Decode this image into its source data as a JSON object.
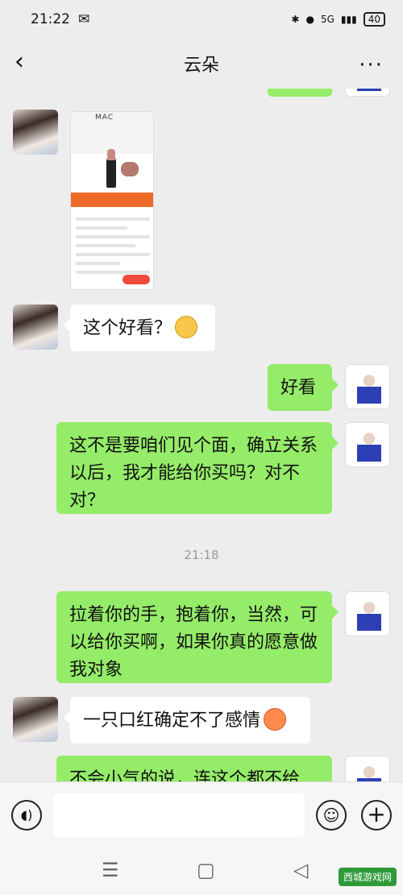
{
  "status": {
    "time": "21:22",
    "signal": "5G",
    "battery": "40"
  },
  "header": {
    "title": "云朵",
    "back_icon": "‹",
    "more_icon": "···"
  },
  "messages": {
    "m2": "这个好看？",
    "m3": "好看",
    "m4": "这不是要咱们见个面，确立关系以后，我才能给你买吗？对不对？",
    "timestamp": "21:18",
    "m5": "拉着你的手，抱着你，当然，可以给你买啊，如果你真的愿意做我对象",
    "m6": "一只口红确定不了感情",
    "m7": "不会小气的说，连这个都不给"
  },
  "shared_screenshot": {
    "brand": "MAC"
  },
  "inputbar": {
    "placeholder": "",
    "voice_icon": "◖)",
    "emoji_icon": "☺",
    "plus_icon": "+"
  },
  "sysnav": {
    "menu": "☰",
    "home": "▢",
    "back": "◁"
  },
  "watermark": {
    "text": "西城游戏网"
  },
  "colors": {
    "outgoing_bubble": "#95ec69",
    "incoming_bubble": "#ffffff",
    "background": "#ededed"
  }
}
